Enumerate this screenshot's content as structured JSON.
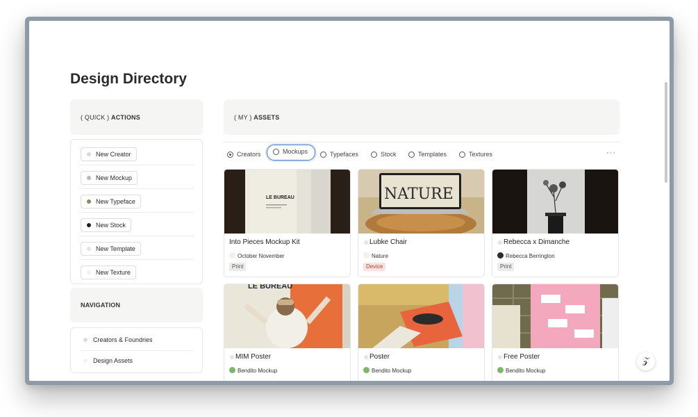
{
  "page": {
    "title": "Design Directory"
  },
  "quick_actions": {
    "header_prefix": "( QUICK )",
    "header_bold": "ACTIONS",
    "items": [
      {
        "label": "New Creator",
        "dot_color": "#d9d9d9"
      },
      {
        "label": "New Mockup",
        "dot_color": "#b8b8b8"
      },
      {
        "label": "New Typeface",
        "dot_color": "#8a8a5c"
      },
      {
        "label": "New Stock",
        "dot_color": "#1e1e1e"
      },
      {
        "label": "New Template",
        "dot_color": "#e3e3e3"
      },
      {
        "label": "New Texture",
        "dot_color": "#f3f3f3"
      }
    ]
  },
  "navigation": {
    "header": "NAVIGATION",
    "items": [
      {
        "label": "Creators & Foundries",
        "dot_color": "#dcdcdc"
      },
      {
        "label": "Design Assets",
        "dot_color": "#f2f2f2"
      }
    ]
  },
  "assets": {
    "header_prefix": "( MY )",
    "header_bold": "ASSETS",
    "tabs": [
      {
        "label": "Creators",
        "icon": "radio-filled-icon",
        "active": false
      },
      {
        "label": "Mockups",
        "icon": "radio-icon",
        "active": true
      },
      {
        "label": "Typefaces",
        "icon": "radio-icon",
        "active": false
      },
      {
        "label": "Stock",
        "icon": "radio-icon",
        "active": false
      },
      {
        "label": "Templates",
        "icon": "radio-icon",
        "active": false
      },
      {
        "label": "Textures",
        "icon": "radio-icon",
        "active": false
      }
    ],
    "more_label": "···",
    "cards": [
      {
        "title": "Into Pieces Mockup Kit",
        "creator": "October November",
        "creator_color": "#f4efe8",
        "tag": "Print",
        "tag_style": "print",
        "thumb_text": "LE BUREAU"
      },
      {
        "title": "Lubke Chair",
        "creator": "Nature",
        "creator_color": "#fbeee4",
        "tag": "Device",
        "tag_style": "device",
        "thumb_text": "NATURE"
      },
      {
        "title": "Rebecca x Dimanche",
        "creator": "Rebecca Berrington",
        "creator_color": "#2c2c2c",
        "tag": "Print",
        "tag_style": "print",
        "thumb_text": ""
      },
      {
        "title": "MIM Poster",
        "creator": "Bendito Mockup",
        "creator_color": "#7db869",
        "tag": "",
        "tag_style": "print",
        "thumb_text": "LE BUREAU"
      },
      {
        "title": "Poster",
        "creator": "Bendito Mockup",
        "creator_color": "#7db869",
        "tag": "",
        "tag_style": "print",
        "thumb_text": ""
      },
      {
        "title": "Free Poster",
        "creator": "Bendito Mockup",
        "creator_color": "#7db869",
        "tag": "",
        "tag_style": "print",
        "thumb_text": ""
      }
    ]
  },
  "fab": {
    "label": "𝒵"
  }
}
